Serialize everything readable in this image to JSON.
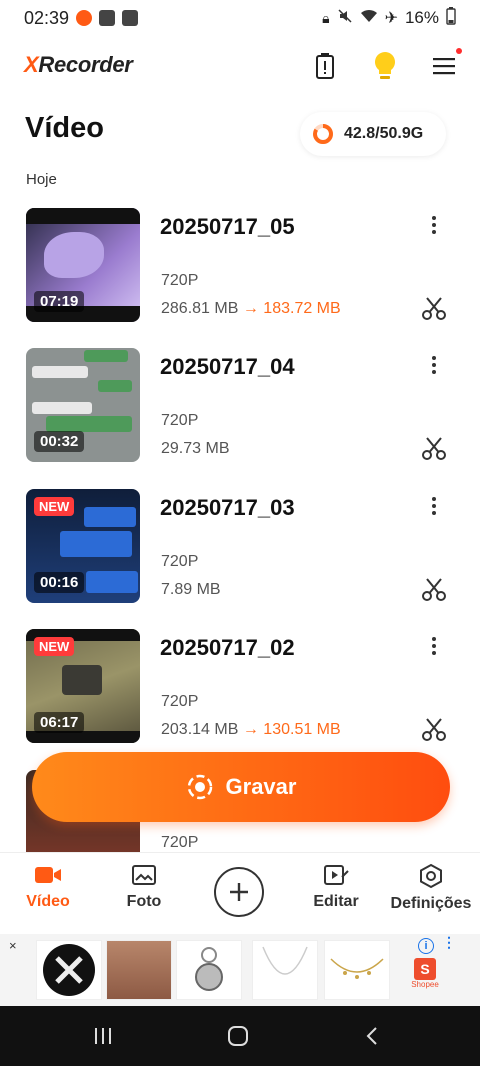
{
  "status": {
    "time": "02:39",
    "battery": "16%"
  },
  "app": {
    "logo_x": "X",
    "logo_rest": "Recorder"
  },
  "page": {
    "title": "Vídeo",
    "storage": "42.8/50.9G",
    "section": "Hoje"
  },
  "videos": [
    {
      "title": "20250717_05",
      "duration": "07:19",
      "resolution": "720P",
      "size": "286.81 MB",
      "arrow": "→",
      "new_size": "183.72 MB",
      "badge": ""
    },
    {
      "title": "20250717_04",
      "duration": "00:32",
      "resolution": "720P",
      "size": "29.73 MB",
      "arrow": "",
      "new_size": "",
      "badge": ""
    },
    {
      "title": "20250717_03",
      "duration": "00:16",
      "resolution": "720P",
      "size": "7.89 MB",
      "arrow": "",
      "new_size": "",
      "badge": "NEW"
    },
    {
      "title": "20250717_02",
      "duration": "06:17",
      "resolution": "720P",
      "size": "203.14 MB",
      "arrow": "→",
      "new_size": "130.51 MB",
      "badge": "NEW"
    },
    {
      "resolution": "720P"
    }
  ],
  "record_button": {
    "label": "Gravar"
  },
  "nav": {
    "video": "Vídeo",
    "photo": "Foto",
    "edit": "Editar",
    "settings": "Definições"
  },
  "ad": {
    "close": "×",
    "brand": "Shopee"
  },
  "colors": {
    "accent": "#ff5a14",
    "accent_light": "#ff8a1a"
  }
}
